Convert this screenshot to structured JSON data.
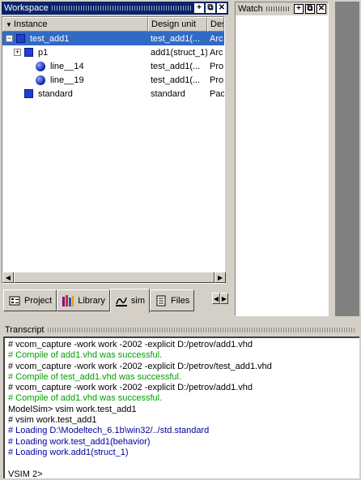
{
  "workspace": {
    "title": "Workspace",
    "columns": [
      "Instance",
      "Design unit",
      "Des"
    ],
    "rows": [
      {
        "name": "test_add1",
        "unit": "test_add1(...",
        "type": "Arc",
        "icon": "square-icon",
        "expander": "−",
        "selected": true
      },
      {
        "name": "p1",
        "unit": "add1(struct_1)",
        "type": "Arc",
        "icon": "square-icon",
        "expander": "+",
        "selected": false
      },
      {
        "name": "line__14",
        "unit": "test_add1(...",
        "type": "Pro",
        "icon": "ball-icon",
        "expander": "",
        "selected": false
      },
      {
        "name": "line__19",
        "unit": "test_add1(...",
        "type": "Pro",
        "icon": "ball-icon",
        "expander": "",
        "selected": false
      },
      {
        "name": "standard",
        "unit": "standard",
        "type": "Pac",
        "icon": "square-icon",
        "expander": "",
        "selected": false
      }
    ],
    "tabs": [
      {
        "label": "Project",
        "icon": "project-icon"
      },
      {
        "label": "Library",
        "icon": "library-icon"
      },
      {
        "label": "sim",
        "icon": "sim-icon"
      },
      {
        "label": "Files",
        "icon": "files-icon"
      }
    ],
    "active_tab": "sim"
  },
  "watch": {
    "title": "Watch"
  },
  "transcript": {
    "title": "Transcript",
    "lines": [
      {
        "text": "# vcom_capture -work work -2002 -explicit D:/petrov/add1.vhd",
        "kind": "cmd"
      },
      {
        "text": "# Compile of add1.vhd was successful.",
        "kind": "ok"
      },
      {
        "text": "# vcom_capture -work work -2002 -explicit D:/petrov/test_add1.vhd",
        "kind": "cmd"
      },
      {
        "text": "# Compile of test_add1.vhd was successful.",
        "kind": "ok"
      },
      {
        "text": "# vcom_capture -work work -2002 -explicit D:/petrov/add1.vhd",
        "kind": "cmd"
      },
      {
        "text": "# Compile of add1.vhd was successful.",
        "kind": "ok"
      },
      {
        "text": "ModelSim>  vsim work.test_add1",
        "kind": "prompt"
      },
      {
        "text": "# vsim work.test_add1",
        "kind": "cmd"
      },
      {
        "text": "# Loading D:\\Modeltech_6.1b\\win32/../std.standard",
        "kind": "load"
      },
      {
        "text": "# Loading work.test_add1(behavior)",
        "kind": "load"
      },
      {
        "text": "# Loading work.add1(struct_1)",
        "kind": "load"
      },
      {
        "text": "",
        "kind": "cmd"
      },
      {
        "text": "VSIM 2>",
        "kind": "prompt"
      }
    ]
  },
  "colors": {
    "active_title": "#0a246a",
    "selection": "#316ac5",
    "compile_ok": "#00a000",
    "loading": "#0000a0"
  }
}
